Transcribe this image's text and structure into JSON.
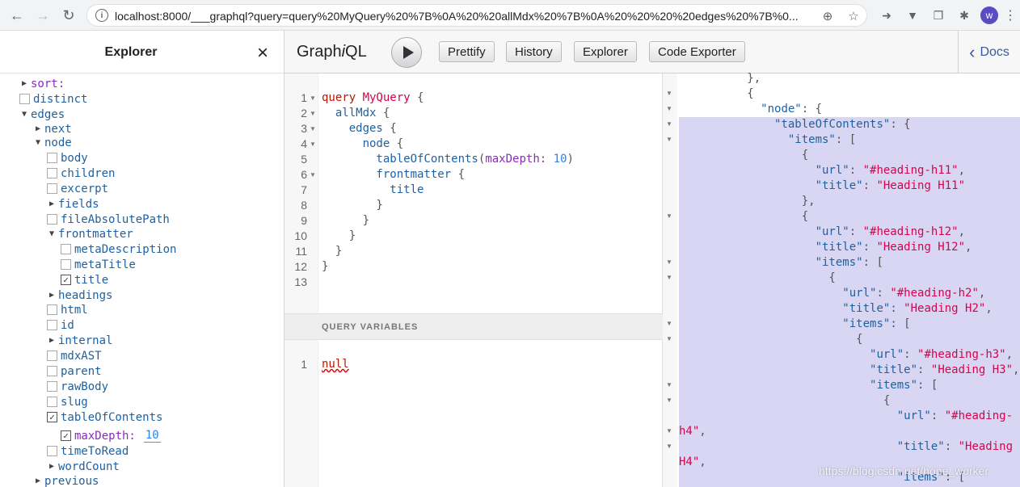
{
  "browser": {
    "url": "localhost:8000/___graphql?query=query%20MyQuery%20%7B%0A%20%20allMdx%20%7B%0A%20%20%20%20edges%20%7B%0...",
    "avatar_letter": "w"
  },
  "explorer": {
    "title": "Explorer",
    "close_glyph": "×",
    "rows": [
      {
        "label": "sort:",
        "kind": "arrow",
        "depth": 0,
        "arg": true
      },
      {
        "label": "distinct",
        "kind": "checkbox",
        "depth": 0,
        "checked": false
      },
      {
        "label": "edges",
        "kind": "arrow-open",
        "depth": 0
      },
      {
        "label": "next",
        "kind": "arrow",
        "depth": 1
      },
      {
        "label": "node",
        "kind": "arrow-open",
        "depth": 1
      },
      {
        "label": "body",
        "kind": "checkbox",
        "depth": 2,
        "checked": false
      },
      {
        "label": "children",
        "kind": "checkbox",
        "depth": 2,
        "checked": false
      },
      {
        "label": "excerpt",
        "kind": "checkbox",
        "depth": 2,
        "checked": false
      },
      {
        "label": "fields",
        "kind": "arrow",
        "depth": 2
      },
      {
        "label": "fileAbsolutePath",
        "kind": "checkbox",
        "depth": 2,
        "checked": false
      },
      {
        "label": "frontmatter",
        "kind": "arrow-open",
        "depth": 2
      },
      {
        "label": "metaDescription",
        "kind": "checkbox",
        "depth": 3,
        "checked": false
      },
      {
        "label": "metaTitle",
        "kind": "checkbox",
        "depth": 3,
        "checked": false
      },
      {
        "label": "title",
        "kind": "checkbox",
        "depth": 3,
        "checked": true
      },
      {
        "label": "headings",
        "kind": "arrow",
        "depth": 2
      },
      {
        "label": "html",
        "kind": "checkbox",
        "depth": 2,
        "checked": false
      },
      {
        "label": "id",
        "kind": "checkbox",
        "depth": 2,
        "checked": false
      },
      {
        "label": "internal",
        "kind": "arrow",
        "depth": 2
      },
      {
        "label": "mdxAST",
        "kind": "checkbox",
        "depth": 2,
        "checked": false
      },
      {
        "label": "parent",
        "kind": "checkbox",
        "depth": 2,
        "checked": false
      },
      {
        "label": "rawBody",
        "kind": "checkbox",
        "depth": 2,
        "checked": false
      },
      {
        "label": "slug",
        "kind": "checkbox",
        "depth": 2,
        "checked": false
      },
      {
        "label": "tableOfContents",
        "kind": "checkbox",
        "depth": 2,
        "checked": true
      },
      {
        "label": "maxDepth:",
        "kind": "checkbox",
        "depth": 3,
        "checked": true,
        "arg": true,
        "value": "10"
      },
      {
        "label": "timeToRead",
        "kind": "checkbox",
        "depth": 2,
        "checked": false
      },
      {
        "label": "wordCount",
        "kind": "arrow",
        "depth": 2
      },
      {
        "label": "previous",
        "kind": "arrow",
        "depth": 1
      }
    ]
  },
  "toolbar": {
    "logo_prefix": "Graph",
    "logo_i": "i",
    "logo_suffix": "QL",
    "buttons": [
      "Prettify",
      "History",
      "Explorer",
      "Code Exporter"
    ],
    "docs": "Docs"
  },
  "query_editor": {
    "line_numbers": [
      "1",
      "2",
      "3",
      "4",
      "5",
      "6",
      "7",
      "8",
      "9",
      "10",
      "11",
      "12",
      "13"
    ],
    "lines": [
      [
        {
          "t": "query ",
          "c": "kw"
        },
        {
          "t": "MyQuery",
          "c": "def"
        },
        {
          "t": " {",
          "c": "punc"
        }
      ],
      [
        {
          "t": "  allMdx",
          "c": "prop"
        },
        {
          "t": " {",
          "c": "punc"
        }
      ],
      [
        {
          "t": "    edges",
          "c": "prop"
        },
        {
          "t": " {",
          "c": "punc"
        }
      ],
      [
        {
          "t": "      node",
          "c": "prop"
        },
        {
          "t": " {",
          "c": "punc"
        }
      ],
      [
        {
          "t": "        tableOfContents",
          "c": "prop"
        },
        {
          "t": "(",
          "c": "punc"
        },
        {
          "t": "maxDepth",
          "c": "attr"
        },
        {
          "t": ": ",
          "c": "punc"
        },
        {
          "t": "10",
          "c": "num"
        },
        {
          "t": ")",
          "c": "punc"
        }
      ],
      [
        {
          "t": "        frontmatter",
          "c": "prop"
        },
        {
          "t": " {",
          "c": "punc"
        }
      ],
      [
        {
          "t": "          title",
          "c": "prop"
        }
      ],
      [
        {
          "t": "        }",
          "c": "punc"
        }
      ],
      [
        {
          "t": "      }",
          "c": "punc"
        }
      ],
      [
        {
          "t": "    }",
          "c": "punc"
        }
      ],
      [
        {
          "t": "  }",
          "c": "punc"
        }
      ],
      [
        {
          "t": "}",
          "c": "punc"
        }
      ],
      []
    ]
  },
  "variables": {
    "title": "QUERY VARIABLES",
    "line_number": "1",
    "value": "null"
  },
  "result": {
    "lines": [
      [
        {
          "t": "          },",
          "c": "punc"
        }
      ],
      [
        {
          "t": "          {",
          "c": "punc"
        }
      ],
      [
        {
          "t": "            ",
          "c": "punc"
        },
        {
          "t": "\"node\"",
          "c": "key"
        },
        {
          "t": ": {",
          "c": "punc"
        }
      ],
      [
        {
          "t": "              ",
          "c": "punc"
        },
        {
          "t": "\"tableOfContents\"",
          "c": "key"
        },
        {
          "t": ": {",
          "c": "punc"
        }
      ],
      [
        {
          "t": "                ",
          "c": "punc"
        },
        {
          "t": "\"items\"",
          "c": "key"
        },
        {
          "t": ": [",
          "c": "punc"
        }
      ],
      [
        {
          "t": "                  {",
          "c": "punc"
        }
      ],
      [
        {
          "t": "                    ",
          "c": "punc"
        },
        {
          "t": "\"url\"",
          "c": "key"
        },
        {
          "t": ": ",
          "c": "punc"
        },
        {
          "t": "\"#heading-h11\"",
          "c": "str"
        },
        {
          "t": ",",
          "c": "punc"
        }
      ],
      [
        {
          "t": "                    ",
          "c": "punc"
        },
        {
          "t": "\"title\"",
          "c": "key"
        },
        {
          "t": ": ",
          "c": "punc"
        },
        {
          "t": "\"Heading H11\"",
          "c": "str"
        }
      ],
      [
        {
          "t": "                  },",
          "c": "punc"
        }
      ],
      [
        {
          "t": "                  {",
          "c": "punc"
        }
      ],
      [
        {
          "t": "                    ",
          "c": "punc"
        },
        {
          "t": "\"url\"",
          "c": "key"
        },
        {
          "t": ": ",
          "c": "punc"
        },
        {
          "t": "\"#heading-h12\"",
          "c": "str"
        },
        {
          "t": ",",
          "c": "punc"
        }
      ],
      [
        {
          "t": "                    ",
          "c": "punc"
        },
        {
          "t": "\"title\"",
          "c": "key"
        },
        {
          "t": ": ",
          "c": "punc"
        },
        {
          "t": "\"Heading H12\"",
          "c": "str"
        },
        {
          "t": ",",
          "c": "punc"
        }
      ],
      [
        {
          "t": "                    ",
          "c": "punc"
        },
        {
          "t": "\"items\"",
          "c": "key"
        },
        {
          "t": ": [",
          "c": "punc"
        }
      ],
      [
        {
          "t": "                      {",
          "c": "punc"
        }
      ],
      [
        {
          "t": "                        ",
          "c": "punc"
        },
        {
          "t": "\"url\"",
          "c": "key"
        },
        {
          "t": ": ",
          "c": "punc"
        },
        {
          "t": "\"#heading-h2\"",
          "c": "str"
        },
        {
          "t": ",",
          "c": "punc"
        }
      ],
      [
        {
          "t": "                        ",
          "c": "punc"
        },
        {
          "t": "\"title\"",
          "c": "key"
        },
        {
          "t": ": ",
          "c": "punc"
        },
        {
          "t": "\"Heading H2\"",
          "c": "str"
        },
        {
          "t": ",",
          "c": "punc"
        }
      ],
      [
        {
          "t": "                        ",
          "c": "punc"
        },
        {
          "t": "\"items\"",
          "c": "key"
        },
        {
          "t": ": [",
          "c": "punc"
        }
      ],
      [
        {
          "t": "                          {",
          "c": "punc"
        }
      ],
      [
        {
          "t": "                            ",
          "c": "punc"
        },
        {
          "t": "\"url\"",
          "c": "key"
        },
        {
          "t": ": ",
          "c": "punc"
        },
        {
          "t": "\"#heading-h3\"",
          "c": "str"
        },
        {
          "t": ",",
          "c": "punc"
        }
      ],
      [
        {
          "t": "                            ",
          "c": "punc"
        },
        {
          "t": "\"title\"",
          "c": "key"
        },
        {
          "t": ": ",
          "c": "punc"
        },
        {
          "t": "\"Heading H3\"",
          "c": "str"
        },
        {
          "t": ",",
          "c": "punc"
        }
      ],
      [
        {
          "t": "                            ",
          "c": "punc"
        },
        {
          "t": "\"items\"",
          "c": "key"
        },
        {
          "t": ": [",
          "c": "punc"
        }
      ],
      [
        {
          "t": "                              {",
          "c": "punc"
        }
      ],
      [
        {
          "t": "                                ",
          "c": "punc"
        },
        {
          "t": "\"url\"",
          "c": "key"
        },
        {
          "t": ": ",
          "c": "punc"
        },
        {
          "t": "\"#heading-",
          "c": "str"
        }
      ],
      [
        {
          "t": "h4\"",
          "c": "str"
        },
        {
          "t": ",",
          "c": "punc"
        }
      ],
      [
        {
          "t": "                                ",
          "c": "punc"
        },
        {
          "t": "\"title\"",
          "c": "key"
        },
        {
          "t": ": ",
          "c": "punc"
        },
        {
          "t": "\"Heading",
          "c": "str"
        }
      ],
      [
        {
          "t": "H4\"",
          "c": "str"
        },
        {
          "t": ",",
          "c": "punc"
        }
      ],
      [
        {
          "t": "                                ",
          "c": "punc"
        },
        {
          "t": "\"items\"",
          "c": "key"
        },
        {
          "t": ": [",
          "c": "punc"
        }
      ]
    ]
  },
  "watermark": "https://blog.csdn.net/hope_worker"
}
